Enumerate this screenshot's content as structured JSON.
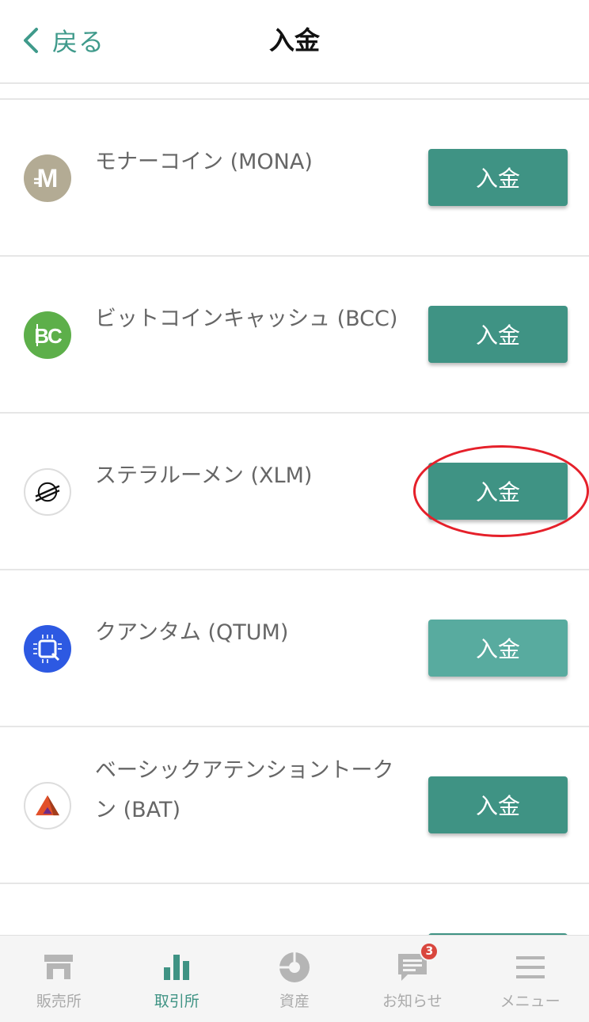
{
  "header": {
    "back_label": "戻る",
    "title": "入金"
  },
  "coins": [
    {
      "name": "モナーコイン (MONA)",
      "button": "入金",
      "icon": "mona-icon",
      "color": "#b3ab94"
    },
    {
      "name": "ビットコインキャッシュ (BCC)",
      "button": "入金",
      "icon": "bcc-icon",
      "color": "#5daf4a"
    },
    {
      "name": "ステラルーメン (XLM)",
      "button": "入金",
      "icon": "xlm-icon",
      "color": "#ffffff",
      "highlighted": true
    },
    {
      "name": "クアンタム (QTUM)",
      "button": "入金",
      "icon": "qtum-icon",
      "color": "#2d59e2",
      "button_state": "pressed"
    },
    {
      "name": "ベーシックアテンショントークン (BAT)",
      "button": "入金",
      "icon": "bat-icon",
      "color": "#ffffff"
    }
  ],
  "tabbar": {
    "tabs": [
      {
        "label": "販売所",
        "icon": "store-icon",
        "active": false
      },
      {
        "label": "取引所",
        "icon": "bar-chart-icon",
        "active": true
      },
      {
        "label": "資産",
        "icon": "pie-chart-icon",
        "active": false
      },
      {
        "label": "お知らせ",
        "icon": "message-icon",
        "active": false,
        "badge": "3"
      },
      {
        "label": "メニュー",
        "icon": "hamburger-menu-icon",
        "active": false
      }
    ]
  },
  "colors": {
    "accent": "#3f9384",
    "highlight": "#e5202a"
  }
}
